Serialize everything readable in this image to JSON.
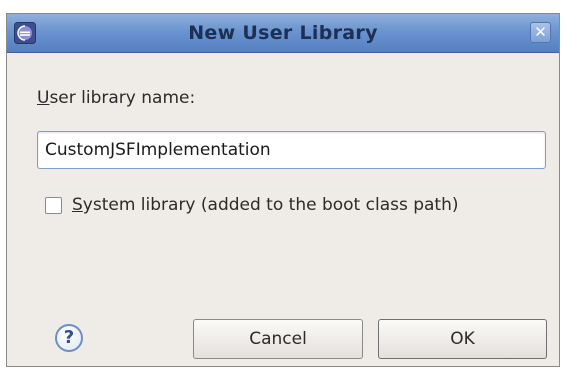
{
  "window": {
    "title": "New User Library",
    "close_glyph": "✕",
    "app_icon": "eclipse-icon",
    "title_bar_color": "#6a94cf"
  },
  "form": {
    "name_label_mnemonic": "U",
    "name_label_rest": "ser library name:",
    "name_value": "CustomJSFImplementation",
    "system_library": {
      "checked": false,
      "label_mnemonic": "S",
      "label_rest": "ystem library (added to the boot class path)"
    }
  },
  "buttons": {
    "help_glyph": "?",
    "cancel_label": "Cancel",
    "ok_label": "OK"
  }
}
